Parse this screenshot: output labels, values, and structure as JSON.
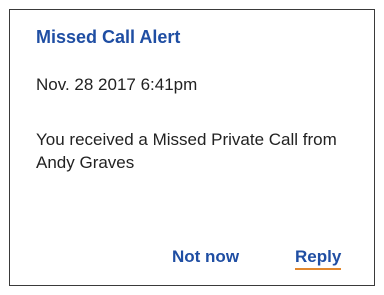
{
  "dialog": {
    "title": "Missed Call Alert",
    "timestamp": "Nov. 28 2017 6:41pm",
    "message": "You received a Missed Private Call from Andy Graves",
    "actions": {
      "not_now_label": "Not now",
      "reply_label": "Reply"
    }
  },
  "colors": {
    "accent": "#1f4ea3",
    "text": "#222222",
    "focus_underline": "#e2872c",
    "border": "#3a3a3a"
  }
}
